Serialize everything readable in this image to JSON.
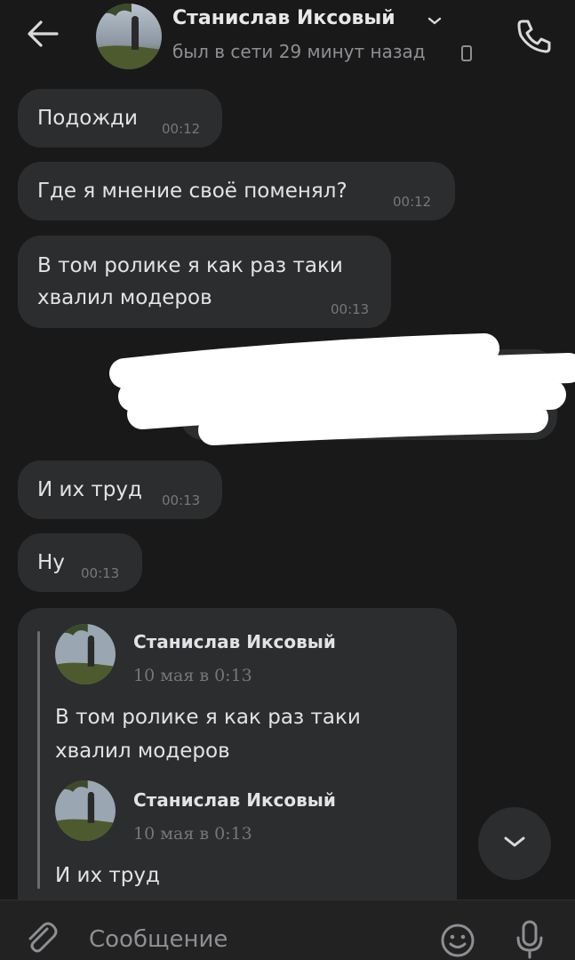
{
  "header": {
    "name": "Станислав Иксовый",
    "status": "был в сети 29 минут назад"
  },
  "messages": [
    {
      "text": "Подожди",
      "time": "00:12"
    },
    {
      "text": "Где я мнение своё поменял?",
      "time": "00:12"
    },
    {
      "text": "В том ролике я как раз таки хвалил модеров",
      "time": "00:13"
    },
    {
      "text": "И их труд",
      "time": "00:13"
    },
    {
      "text": "Ну",
      "time": "00:13"
    }
  ],
  "forwarded": [
    {
      "author": "Станислав Иксовый",
      "date": "10 мая в 0:13",
      "text": "В том ролике я как раз таки хвалил модеров"
    },
    {
      "author": "Станислав Иксовый",
      "date": "10 мая в 0:13",
      "text": "И их труд"
    }
  ],
  "composer": {
    "placeholder": "Сообщение"
  },
  "colors": {
    "background": "#19191a",
    "bubble": "#2c2d2e",
    "accent": "#e1e3e6"
  },
  "icons": [
    "back-arrow-icon",
    "chevron-down-icon",
    "phone-device-icon",
    "call-icon",
    "paperclip-icon",
    "emoji-icon",
    "microphone-icon",
    "scroll-down-chevron-icon"
  ]
}
